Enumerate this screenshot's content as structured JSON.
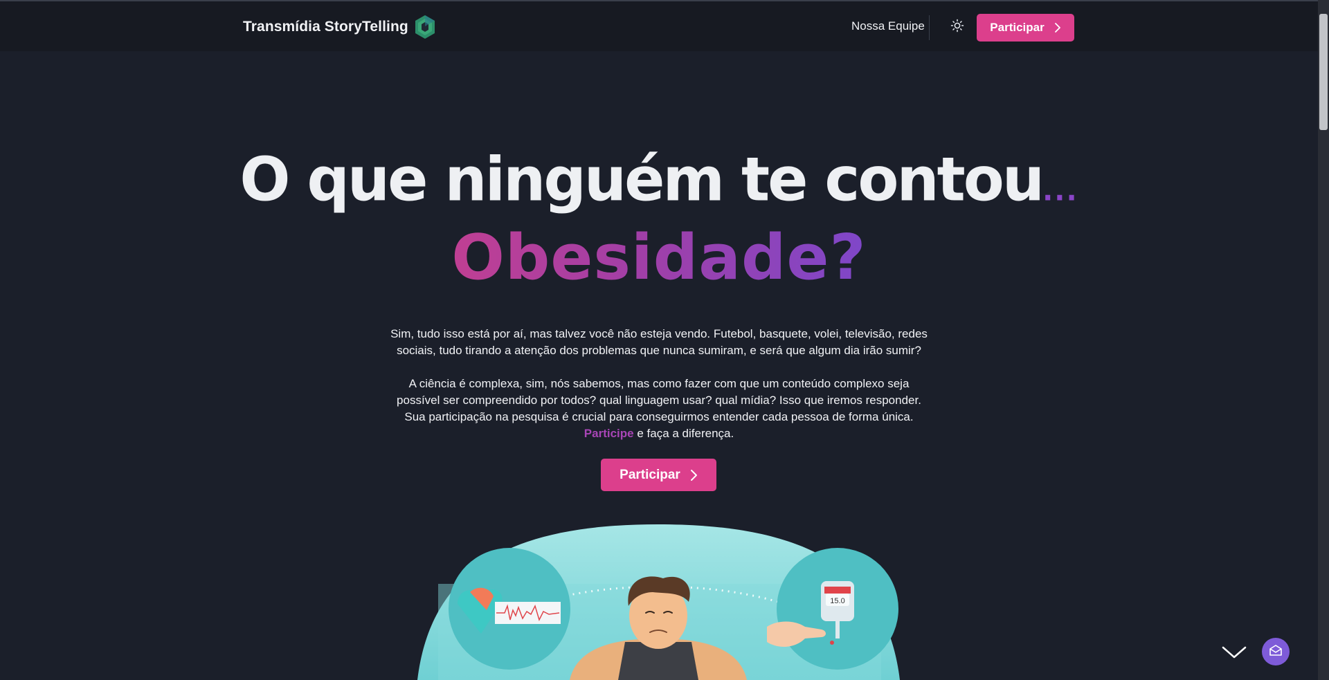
{
  "navbar": {
    "brand_name": "Transmídia StoryTelling",
    "logo_icon": "hexagon-logo-icon",
    "links": [
      "Nossa Equipe"
    ],
    "theme_icon": "sun-icon",
    "cta_label": "Participar"
  },
  "hero": {
    "title": "O que ninguém te contou",
    "title_dots": "...",
    "subtitle": "Obesidade?",
    "paragraph1_line1": "Sim, tudo isso está por aí, mas talvez você não esteja vendo. Futebol, basquete, volei, televisão, redes",
    "paragraph1_line2": "sociais, tudo tirando a atenção dos problemas que nunca sumiram, e será que algum dia irão sumir?",
    "paragraph2_line1": "A ciência é complexa, sim, nós sabemos, mas como fazer com que um conteúdo complexo seja",
    "paragraph2_line2": "possível ser compreendido por todos? qual linguagem usar? qual mídia? Isso que iremos responder.",
    "paragraph2_line3": "Sua participação na pesquisa é crucial para conseguirmos entender cada pessoa de forma única.",
    "paragraph2_accent": "Participe",
    "paragraph2_end": " e faça a diferença.",
    "cta_label": "Participar"
  },
  "illustration": {
    "glucose_reading": "15.0"
  },
  "floating": {
    "scroll_icon": "chevron-down-icon",
    "chat_icon": "mail-open-icon"
  },
  "colors": {
    "background": "#1b1f2a",
    "navbar": "#171a22",
    "accent_pink": "#dc3f8c",
    "accent_purple": "#7f47c9",
    "illustration_teal": "#7fd6d8"
  }
}
